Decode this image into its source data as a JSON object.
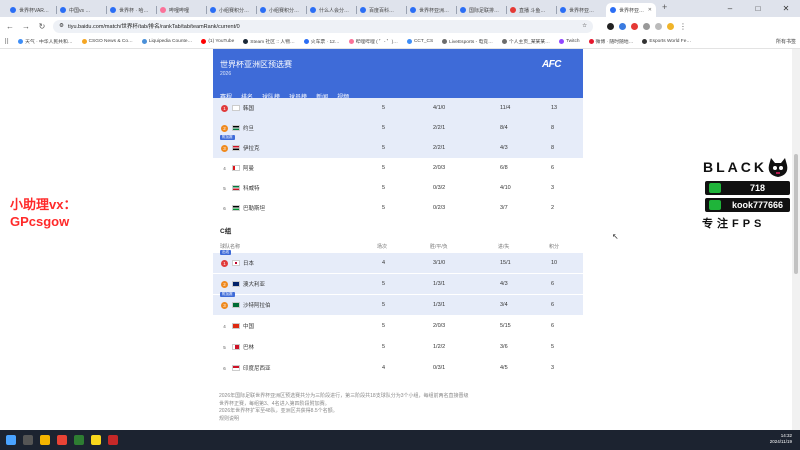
{
  "tabs": [
    {
      "label": "世界杯VAR…",
      "color": "#2b6ef5"
    },
    {
      "label": "中国vs …",
      "color": "#2b6ef5"
    },
    {
      "label": "世界杯 · 哈…",
      "color": "#2b6ef5"
    },
    {
      "label": "哔哩哔哩",
      "color": "#fb7299"
    },
    {
      "label": "小组赛积分…",
      "color": "#2b6ef5"
    },
    {
      "label": "小组赛积分…",
      "color": "#2b6ef5"
    },
    {
      "label": "什么人会分…",
      "color": "#2b6ef5"
    },
    {
      "label": "百度百科…",
      "color": "#2b6ef5"
    },
    {
      "label": "世界杯亚洲…",
      "color": "#2b6ef5"
    },
    {
      "label": "国际足联排…",
      "color": "#2b6ef5"
    },
    {
      "label": "直播 斗鱼…",
      "color": "#e53935"
    },
    {
      "label": "世界杯亚…",
      "color": "#2b6ef5"
    },
    {
      "label": "世界杯亚…",
      "color": "#2b6ef5",
      "active": true
    }
  ],
  "address": "tiyu.baidu.com/match/世界杯/tab/排名/rankTab/tab/teamRank/current/0",
  "bookmarks": [
    {
      "label": "天气 · 中华人民共和…",
      "color": "#3e8ef7"
    },
    {
      "label": "CSGO News & Co…",
      "color": "#f5a623"
    },
    {
      "label": "Liquipedia Counte…",
      "color": "#4a90d9"
    },
    {
      "label": "(1) YouTube",
      "color": "#ff0000"
    },
    {
      "label": "Steam 社区 :: 人物…",
      "color": "#1b2838"
    },
    {
      "label": "火车票 · 12…",
      "color": "#2b6ef5"
    },
    {
      "label": "哔哩哔哩 ( ゜- ゜)…",
      "color": "#fb7299"
    },
    {
      "label": "CCT_CS",
      "color": "#3e8ef7"
    },
    {
      "label": "LiveEsports - 电竞…",
      "color": "#6c6c6c"
    },
    {
      "label": "个人主页_某某某…",
      "color": "#6c6c6c"
    },
    {
      "label": "Twitch",
      "color": "#9146ff"
    },
    {
      "label": "微博 · 随时随地…",
      "color": "#e6162d"
    },
    {
      "label": "Esports World Fe…",
      "color": "#333333"
    }
  ],
  "bookmarks_more": "所有书签",
  "banner": {
    "title": "世界杯亚洲区预选赛",
    "year": "2026",
    "logo": "AFC",
    "nav": [
      "赛程",
      "排名",
      "球队榜",
      "球员榜",
      "新闻",
      "视频"
    ]
  },
  "group_b_rows": [
    {
      "rank": "1",
      "team": "韩国",
      "g": "5",
      "wdl": "4/1/0",
      "goals": "11/4",
      "pts": "13",
      "flag": "kr",
      "badge": "red",
      "hl": true
    },
    {
      "rank": "2",
      "team": "约旦",
      "g": "5",
      "wdl": "2/2/1",
      "goals": "8/4",
      "pts": "8",
      "flag": "jo",
      "badge": "orange",
      "hl": true
    },
    {
      "rank": "3",
      "team": "伊拉克",
      "g": "5",
      "wdl": "2/2/1",
      "goals": "4/3",
      "pts": "8",
      "flag": "iq",
      "badge": "orange",
      "hl": true,
      "qual": "附加赛"
    },
    {
      "rank": "4",
      "team": "阿曼",
      "g": "5",
      "wdl": "2/0/3",
      "goals": "6/8",
      "pts": "6",
      "flag": "om",
      "badge": "plain"
    },
    {
      "rank": "5",
      "team": "科威特",
      "g": "5",
      "wdl": "0/3/2",
      "goals": "4/10",
      "pts": "3",
      "flag": "kw",
      "badge": "plain"
    },
    {
      "rank": "6",
      "team": "巴勒斯坦",
      "g": "5",
      "wdl": "0/2/3",
      "goals": "3/7",
      "pts": "2",
      "flag": "ps",
      "badge": "plain"
    }
  ],
  "group_c": {
    "title": "C组",
    "headers": {
      "team": "球队名称",
      "g": "场次",
      "wdl": "胜/平/负",
      "goals": "进/失",
      "pts": "积分"
    },
    "rows": [
      {
        "rank": "1",
        "team": "日本",
        "g": "4",
        "wdl": "3/1/0",
        "goals": "15/1",
        "pts": "10",
        "flag": "jp",
        "badge": "red",
        "hl": true,
        "qual": "出线"
      },
      {
        "rank": "2",
        "team": "澳大利亚",
        "g": "5",
        "wdl": "1/3/1",
        "goals": "4/3",
        "pts": "6",
        "flag": "au",
        "badge": "orange",
        "hl": true
      },
      {
        "rank": "3",
        "team": "沙特阿拉伯",
        "g": "5",
        "wdl": "1/3/1",
        "goals": "3/4",
        "pts": "6",
        "flag": "sa",
        "badge": "orange",
        "hl": true,
        "qual": "附加赛"
      },
      {
        "rank": "4",
        "team": "中国",
        "g": "5",
        "wdl": "2/0/3",
        "goals": "5/15",
        "pts": "6",
        "flag": "cn",
        "badge": "plain"
      },
      {
        "rank": "5",
        "team": "巴林",
        "g": "5",
        "wdl": "1/2/2",
        "goals": "3/6",
        "pts": "5",
        "flag": "bh",
        "badge": "plain"
      },
      {
        "rank": "6",
        "team": "印度尼西亚",
        "g": "4",
        "wdl": "0/3/1",
        "goals": "4/5",
        "pts": "3",
        "flag": "id",
        "badge": "plain"
      }
    ]
  },
  "footnote": [
    "2026年国际足联世界杯亚洲区预选赛共分为三阶段进行，第三阶段共18支球队分为3个小组，每组前两名直接晋级",
    "世界杯正赛，每组第3、4名进入第四阶段附加赛。",
    "2026年世界杯扩军至48队，亚洲区共获得8.5个名额。",
    "规则说明"
  ],
  "promo": [
    "小助理vx：",
    "GPcsgow"
  ],
  "overlay": {
    "word": "BLACK",
    "line1": "718",
    "line2": "kook777666",
    "line3": "专注FPS"
  },
  "tray": {
    "time": "14:32",
    "date": "2024/11/19"
  },
  "colors": {
    "accent": "#3e6bd8",
    "champion": "#e03b3b",
    "playoff": "#ef8a1f",
    "promo": "#ff2a2a"
  }
}
